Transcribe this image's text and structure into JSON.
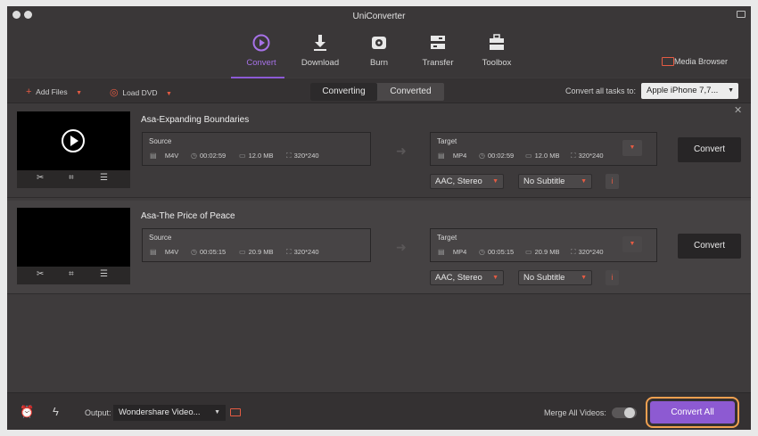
{
  "app": {
    "title": "UniConverter"
  },
  "nav": {
    "items": [
      {
        "label": "Convert",
        "icon": "convert-play-icon",
        "active": true
      },
      {
        "label": "Download",
        "icon": "download-icon"
      },
      {
        "label": "Burn",
        "icon": "disc-icon"
      },
      {
        "label": "Transfer",
        "icon": "transfer-icon"
      },
      {
        "label": "Toolbox",
        "icon": "toolbox-icon"
      }
    ],
    "media_browser": "Media Browser"
  },
  "toolbar": {
    "add_files": "Add Files",
    "load_dvd": "Load DVD",
    "tabs": [
      "Converting",
      "Converted"
    ],
    "convert_all_tasks_label": "Convert all tasks to:",
    "device": "Apple iPhone 7,7..."
  },
  "files": [
    {
      "name": "Asa-Expanding Boundaries",
      "source": {
        "label": "Source",
        "format": "M4V",
        "duration": "00:02:59",
        "size": "12.0 MB",
        "resolution": "320*240"
      },
      "target": {
        "label": "Target",
        "format": "MP4",
        "duration": "00:02:59",
        "size": "12.0 MB",
        "resolution": "320*240"
      },
      "audio": "AAC, Stereo",
      "subtitle": "No Subtitle",
      "convert": "Convert"
    },
    {
      "name": "Asa-The Price of Peace",
      "source": {
        "label": "Source",
        "format": "M4V",
        "duration": "00:05:15",
        "size": "20.9 MB",
        "resolution": "320*240"
      },
      "target": {
        "label": "Target",
        "format": "MP4",
        "duration": "00:05:15",
        "size": "20.9 MB",
        "resolution": "320*240"
      },
      "audio": "AAC, Stereo",
      "subtitle": "No Subtitle",
      "convert": "Convert"
    }
  ],
  "bottom": {
    "output_label": "Output:",
    "output_value": "Wondershare Video...",
    "merge_label": "Merge All Videos:",
    "convert_all": "Convert All"
  },
  "colors": {
    "accent_purple": "#8d5ad2",
    "accent_red": "#e55b43",
    "highlight_orange": "#f0a050"
  }
}
